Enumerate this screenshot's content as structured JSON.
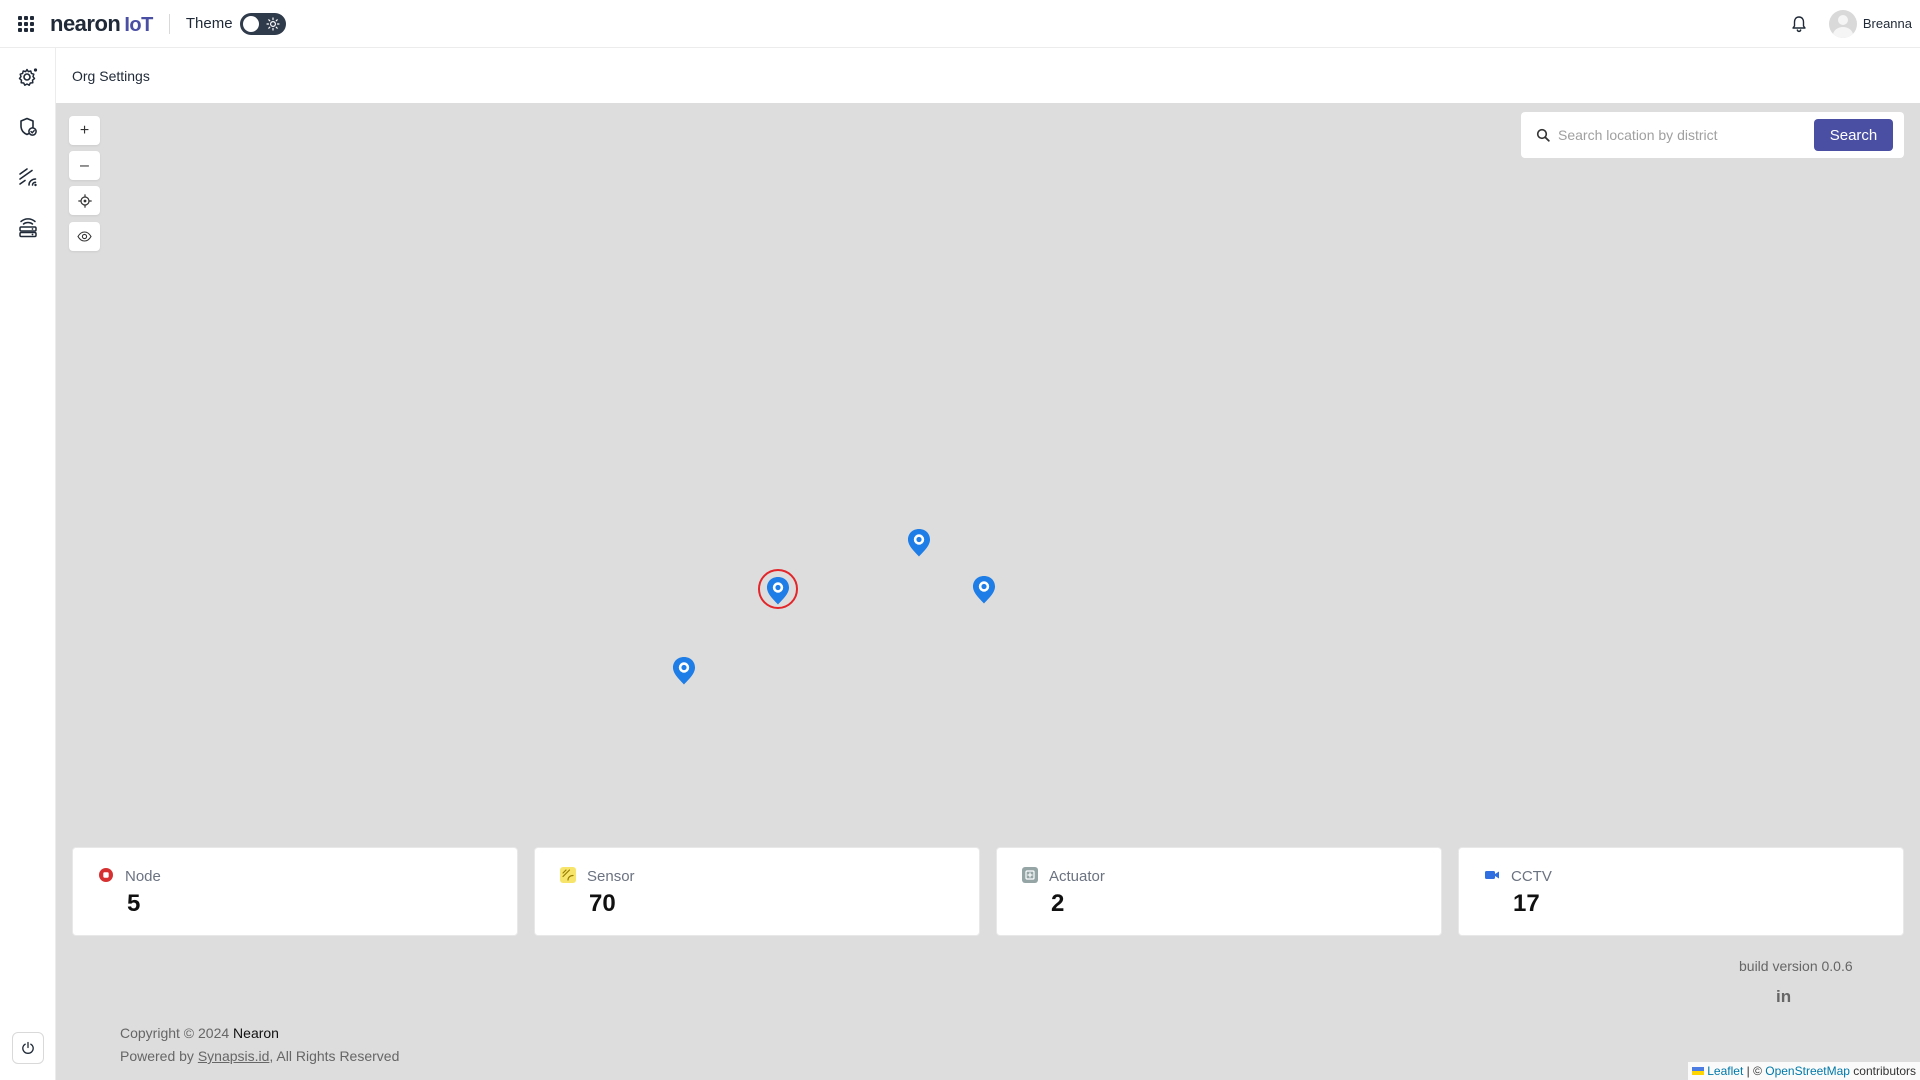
{
  "header": {
    "logo_brand": "nearon",
    "logo_suffix": "IoT",
    "theme_label": "Theme",
    "username": "Breanna"
  },
  "page": {
    "title": "Org Settings"
  },
  "sidebar": {
    "items": [
      {
        "icon": "gear-network-icon"
      },
      {
        "icon": "shield-node-icon"
      },
      {
        "icon": "sensor-signal-icon"
      },
      {
        "icon": "router-icon"
      }
    ],
    "power_icon": "power-icon"
  },
  "map": {
    "controls": [
      "+",
      "–"
    ],
    "search_placeholder": "Search location by district",
    "search_button": "Search",
    "marker_color": "#1e7de6",
    "selected_ring_color": "#e3262a"
  },
  "stats": [
    {
      "label": "Node",
      "value": "5",
      "icon_color": "#d63031"
    },
    {
      "label": "Sensor",
      "value": "70",
      "icon_color": "#e0c21a"
    },
    {
      "label": "Actuator",
      "value": "2",
      "icon_color": "#7f8c8d"
    },
    {
      "label": "CCTV",
      "value": "17",
      "icon_color": "#2f6fe0"
    }
  ],
  "footer": {
    "build_version": "build version 0.0.6",
    "linkedin": "in",
    "copyright_prefix": "Copyright © 2024 ",
    "copyright_company": "Nearon",
    "powered_prefix": "Powered by ",
    "powered_link": "Synapsis.id",
    "powered_suffix": ", All Rights Reserved"
  },
  "attribution": {
    "leaflet": "Leaflet",
    "separator": " | © ",
    "osm": "OpenStreetMap",
    "contributors": " contributors"
  }
}
